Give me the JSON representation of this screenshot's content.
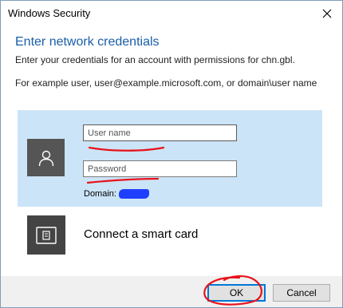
{
  "window": {
    "title": "Windows Security"
  },
  "content": {
    "heading": "Enter network credentials",
    "description": "Enter your credentials for an account with permissions for chn.gbl.",
    "example": "For example user, user@example.microsoft.com, or domain\\user name"
  },
  "credentials": {
    "username_placeholder": "User name",
    "username_value": "",
    "password_placeholder": "Password",
    "password_value": "",
    "domain_label": "Domain:"
  },
  "smartcard": {
    "label": "Connect a smart card"
  },
  "buttons": {
    "ok": "OK",
    "cancel": "Cancel"
  },
  "icons": {
    "close": "close-icon",
    "user": "user-icon",
    "smartcard": "smart-card-icon"
  },
  "colors": {
    "heading": "#1a5ea8",
    "panel": "#cce4f7",
    "annotation": "#e8121a",
    "redaction": "#1f3fff",
    "focus": "#0078d7"
  }
}
